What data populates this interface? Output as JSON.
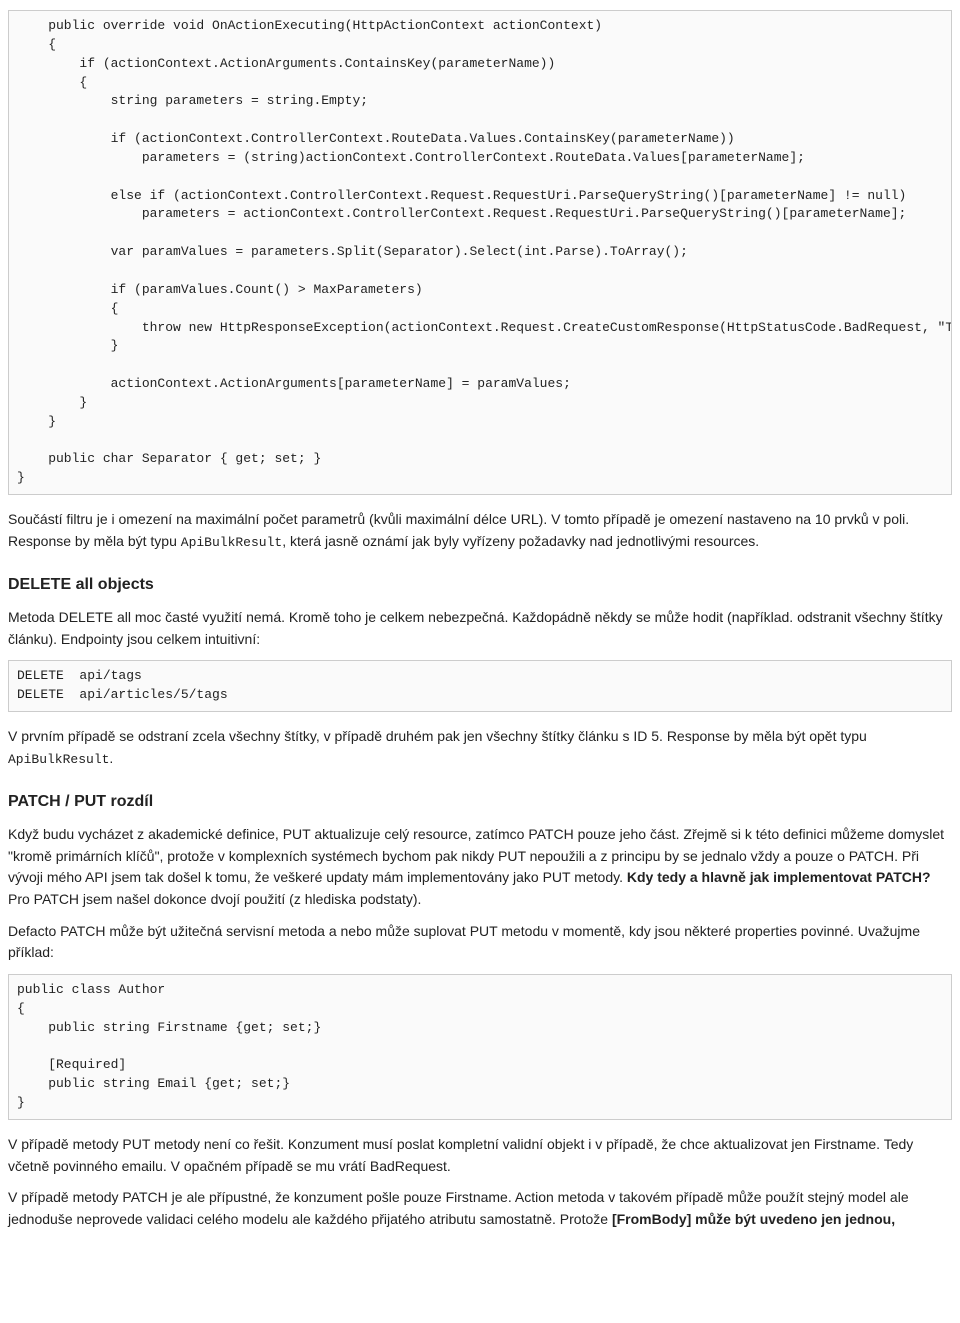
{
  "code1": "    public override void OnActionExecuting(HttpActionContext actionContext)\n    {\n        if (actionContext.ActionArguments.ContainsKey(parameterName))\n        {\n            string parameters = string.Empty;\n\n            if (actionContext.ControllerContext.RouteData.Values.ContainsKey(parameterName))\n                parameters = (string)actionContext.ControllerContext.RouteData.Values[parameterName];\n\n            else if (actionContext.ControllerContext.Request.RequestUri.ParseQueryString()[parameterName] != null)\n                parameters = actionContext.ControllerContext.Request.RequestUri.ParseQueryString()[parameterName];\n\n            var paramValues = parameters.Split(Separator).Select(int.Parse).ToArray();\n\n            if (paramValues.Count() > MaxParameters)\n            {\n                throw new HttpResponseException(actionContext.Request.CreateCustomResponse(HttpStatusCode.BadRequest, \"Too many parameters. Maximum is \" + MaxParameters));\n            }\n\n            actionContext.ActionArguments[parameterName] = paramValues;\n        }\n    }\n\n    public char Separator { get; set; }\n}",
  "p1_a": "Součástí filtru je i omezení na maximální počet parametrů (kvůli maximální délce URL). V tomto případě je omezení nastaveno na 10 prvků v poli. Response by měla být typu ",
  "p1_code": "ApiBulkResult",
  "p1_b": ", která jasně oznámí jak byly vyřízeny požadavky nad jednotlivými resources.",
  "h1": "DELETE all objects",
  "p2": "Metoda DELETE all moc časté využití nemá. Kromě toho je celkem nebezpečná. Každopádně někdy se může hodit (například. odstranit všechny štítky článku). Endpointy jsou celkem intuitivní:",
  "code2": "DELETE  api/tags\nDELETE  api/articles/5/tags",
  "p3_a": "V prvním případě se odstraní zcela všechny štítky, v případě druhém pak jen všechny štítky článku s ID 5. Response by měla být opět typu ",
  "p3_code": "ApiBulkResult",
  "p3_b": ".",
  "h2": "PATCH / PUT rozdíl",
  "p4_a": "Když budu vycházet z akademické definice, PUT aktualizuje celý resource, zatímco PATCH pouze jeho část. Zřejmě si k této definici můžeme domyslet \"kromě primárních klíčů\", protože v komplexních systémech bychom pak nikdy PUT nepoužili a z principu by se jednalo vždy a pouze o PATCH. Při vývoji mého API jsem tak došel k tomu, že veškeré updaty mám implementovány jako PUT metody. ",
  "p4_strong": "Kdy tedy a hlavně jak implementovat PATCH?",
  "p4_b": " Pro PATCH jsem našel dokonce dvojí použití (z hlediska podstaty).",
  "p5": "Defacto PATCH může být užitečná servisní metoda a nebo může suplovat PUT metodu v momentě, kdy jsou některé properties povinné. Uvažujme příklad:",
  "code3": "public class Author\n{\n    public string Firstname {get; set;}\n\n    [Required]\n    public string Email {get; set;}\n}",
  "p6": "V případě metody PUT metody není co řešit. Konzument musí poslat kompletní validní objekt i v případě, že chce aktualizovat jen Firstname. Tedy včetně povinného emailu. V opačném případě se mu vrátí BadRequest.",
  "p7_a": "V případě metody PATCH je ale přípustné, že konzument pošle pouze Firstname. Action metoda v takovém případě může použít stejný model ale jednoduše neprovede validaci celého modelu ale každého přijatého atributu samostatně. Protože ",
  "p7_strong": "[FromBody] může být uvedeno jen jednou,"
}
